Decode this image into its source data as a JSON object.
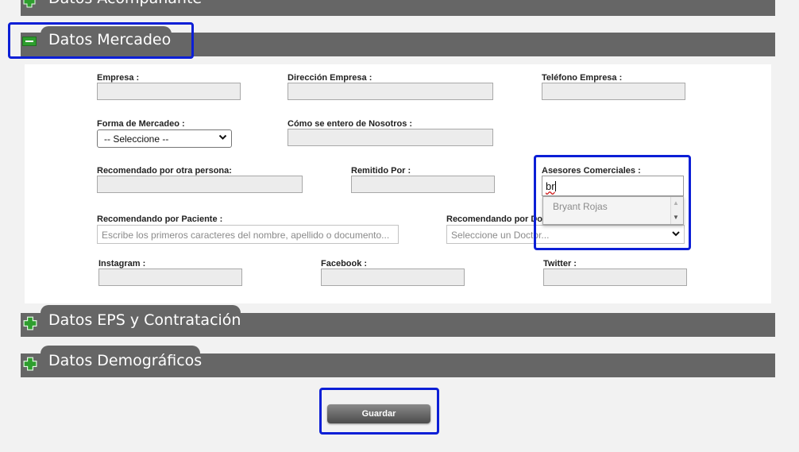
{
  "sections": {
    "acompanante": {
      "title": "Datos Acompañante",
      "state": "collapsed"
    },
    "mercadeo": {
      "title": "Datos Mercadeo",
      "state": "expanded"
    },
    "eps": {
      "title": "Datos EPS y Contratación",
      "state": "collapsed"
    },
    "demograficos": {
      "title": "Datos Demográficos",
      "state": "collapsed"
    }
  },
  "form": {
    "empresa_label": "Empresa :",
    "empresa_value": "",
    "direccion_empresa_label": "Dirección Empresa :",
    "direccion_empresa_value": "",
    "telefono_empresa_label": "Teléfono Empresa :",
    "telefono_empresa_value": "",
    "forma_mercadeo_label": "Forma de Mercadeo :",
    "forma_mercadeo_selected": "-- Seleccione --",
    "como_se_entero_label": "Cómo se entero de Nosotros :",
    "como_se_entero_value": "",
    "recomendado_persona_label": "Recomendado por otra persona:",
    "recomendado_persona_value": "",
    "remitido_por_label": "Remitido Por :",
    "remitido_por_value": "",
    "asesores_label": "Asesores Comerciales :",
    "asesores_value": "br",
    "asesores_suggestions": [
      "Bryant Rojas"
    ],
    "recomendando_paciente_label": "Recomendando por Paciente :",
    "recomendando_paciente_placeholder": "Escribe los primeros caracteres del nombre, apellido o documento...",
    "recomendando_doctor_label": "Recomendando por Do",
    "recomendando_doctor_placeholder": "Seleccione un Doctor...",
    "instagram_label": "Instagram :",
    "instagram_value": "",
    "facebook_label": "Facebook :",
    "facebook_value": "",
    "twitter_label": "Twitter :",
    "twitter_value": ""
  },
  "actions": {
    "save_label": "Guardar"
  },
  "colors": {
    "section_bar": "#666666",
    "accent_green": "#2e9e2e",
    "highlight_blue": "#0c1fd6"
  },
  "icons": {
    "expand": "plus-icon",
    "collapse": "minus-icon"
  }
}
